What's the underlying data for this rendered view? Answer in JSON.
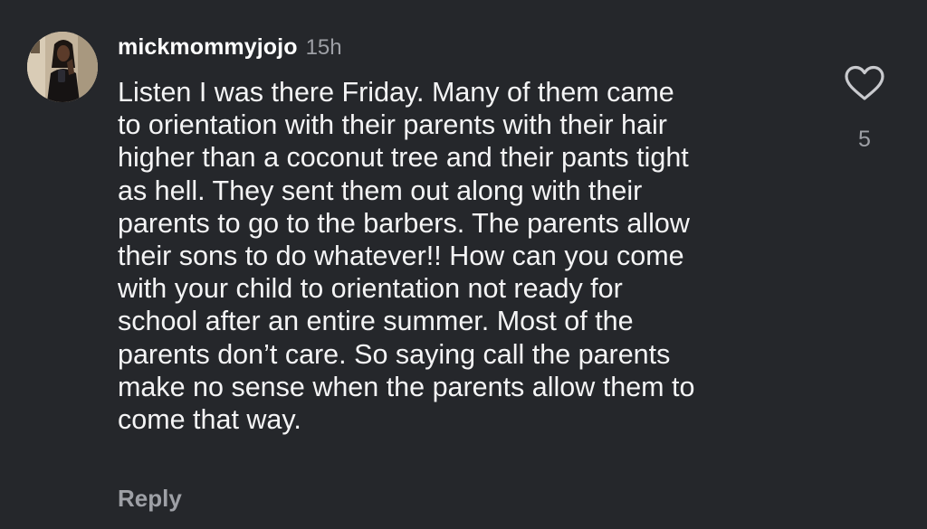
{
  "comment": {
    "username": "mickmommyjojo",
    "time_ago": "15h",
    "text_lines": [
      "Listen I was there Friday. Many of them came",
      "to orientation with their parents with their hair",
      "higher than a coconut tree and their pants tight",
      "as hell. They sent them out along with their",
      "parents to go to the barbers. The parents allow",
      "their sons to do whatever!! How can you come",
      "with your child to orientation not ready for",
      "school after an entire summer. Most of the",
      "parents don’t care. So saying call the parents",
      "make no sense when the parents allow them to",
      "come that way."
    ],
    "reply_label": "Reply",
    "like_count": "5",
    "like_icon": "heart-outline-icon"
  },
  "colors": {
    "background": "#25272b",
    "text": "#f4f4f5",
    "muted": "#9ea0a6"
  }
}
